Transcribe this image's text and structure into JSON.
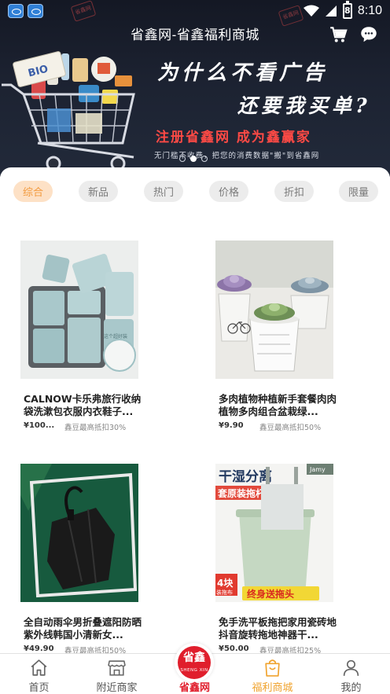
{
  "status_bar": {
    "time": "8:10",
    "battery_label": "8"
  },
  "header": {
    "title": "省鑫网-省鑫福利商城"
  },
  "banner": {
    "headline": "为什么不看广告",
    "subline": "还要我买单?",
    "cta": "注册省鑫网 成为鑫赢家",
    "fine_print": "无门槛不收费，把您的消费数据\"搬\"到省鑫网",
    "box_label": "BIO",
    "watermark": "省鑫网",
    "slides": 3,
    "active_slide": 2
  },
  "filters": [
    {
      "label": "综合",
      "active": true
    },
    {
      "label": "新品",
      "active": false
    },
    {
      "label": "热门",
      "active": false
    },
    {
      "label": "价格",
      "active": false
    },
    {
      "label": "折扣",
      "active": false
    },
    {
      "label": "限量",
      "active": false
    }
  ],
  "products": [
    {
      "name": "CALNOW卡乐弗旅行收纳袋洗漱包衣服内衣鞋子...",
      "price": "¥100...",
      "deduct": "鑫豆最高抵扣30%",
      "image": "travel-storage-bags",
      "image_caption": "这个超好装"
    },
    {
      "name": "多肉植物种植新手套餐肉肉植物多肉组合盆栽绿...",
      "price": "¥9.90",
      "deduct": "鑫豆最高抵扣50%",
      "image": "succulent-plants"
    },
    {
      "name": "全自动雨伞男折叠遮阳防晒紫外线韩国小清新女...",
      "price": "¥49.90",
      "deduct": "鑫豆最高抵扣50%",
      "image": "black-umbrella"
    },
    {
      "name": "免手洗平板拖把家用瓷砖地抖音旋转拖地神器干...",
      "price": "¥50.00",
      "deduct": "鑫豆最高抵扣25%",
      "image": "flat-mop",
      "image_text": {
        "top": "干湿分离",
        "sub": "套原装拖杆",
        "badge": "4块",
        "badge_sub": "装拖布",
        "ribbon": "终身送拖头",
        "brand": "Jamy"
      }
    }
  ],
  "bottom_nav": [
    {
      "label": "首页",
      "icon": "home-icon",
      "active": false
    },
    {
      "label": "附近商家",
      "icon": "store-icon",
      "active": false
    },
    {
      "label": "省鑫网",
      "icon": "brand-logo",
      "active": false,
      "logo_text": "省鑫",
      "logo_sub": "SHENG XIN"
    },
    {
      "label": "福利商城",
      "icon": "shopping-bag-icon",
      "active": true
    },
    {
      "label": "我的",
      "icon": "person-icon",
      "active": false
    }
  ],
  "colors": {
    "accent": "#f0a32e",
    "brand_red": "#e01e2c",
    "chip_active_bg": "#fde1c6",
    "banner_bg": "#1c2231"
  }
}
